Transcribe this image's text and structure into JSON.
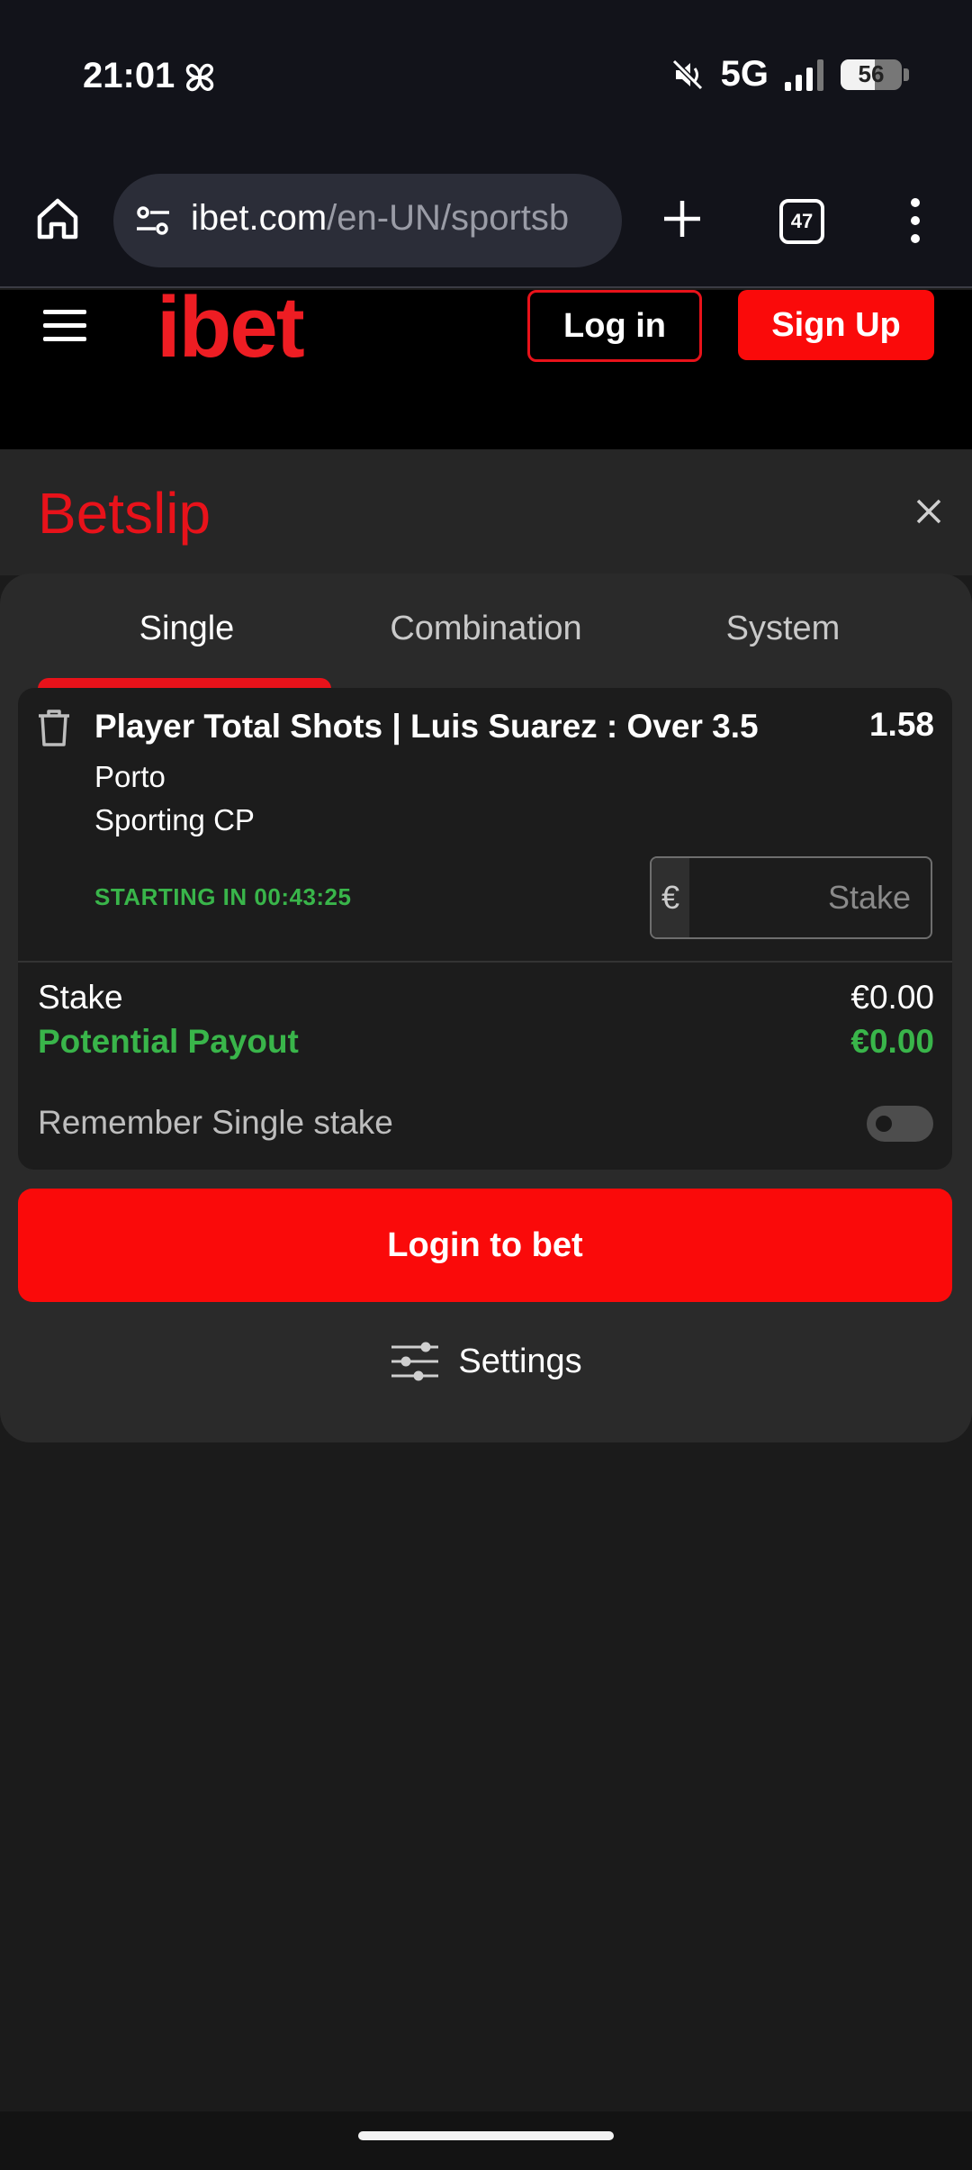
{
  "status_bar": {
    "time": "21:01",
    "network": "5G",
    "battery_percent": "56",
    "battery_level": 0.56,
    "icons": [
      "pinwheel-icon",
      "mute-icon",
      "signal-icon",
      "battery-icon"
    ]
  },
  "browser": {
    "url_domain": "ibet.com",
    "url_path": "/en-UN/sportsb",
    "tab_count": "47",
    "icons": [
      "home-icon",
      "site-info-icon",
      "new-tab-icon",
      "tabs-icon",
      "more-menu-icon"
    ]
  },
  "site_header": {
    "logo_text": "ibet",
    "login_label": "Log in",
    "signup_label": "Sign Up"
  },
  "betslip": {
    "title": "Betslip",
    "tabs": [
      {
        "label": "Single",
        "active": true
      },
      {
        "label": "Combination",
        "active": false
      },
      {
        "label": "System",
        "active": false
      }
    ],
    "selection": {
      "market": "Player Total Shots | Luis Suarez : Over 3.5",
      "odds": "1.58",
      "home_team": "Porto",
      "away_team": "Sporting CP",
      "starting": "STARTING IN 00:43:25",
      "currency_symbol": "€",
      "stake_placeholder": "Stake",
      "stake_value": ""
    },
    "summary": {
      "stake_label": "Stake",
      "stake_value": "€0.00",
      "payout_label": "Potential Payout",
      "payout_value": "€0.00",
      "remember_label": "Remember Single stake",
      "remember_enabled": false
    },
    "login_to_bet_label": "Login to bet",
    "settings_label": "Settings"
  },
  "colors": {
    "brand_red": "#fa0a0a",
    "title_red": "#e8121a",
    "positive_green": "#39b54a",
    "panel_bg": "#2a2a2a",
    "card_bg": "#1c1c1c"
  }
}
